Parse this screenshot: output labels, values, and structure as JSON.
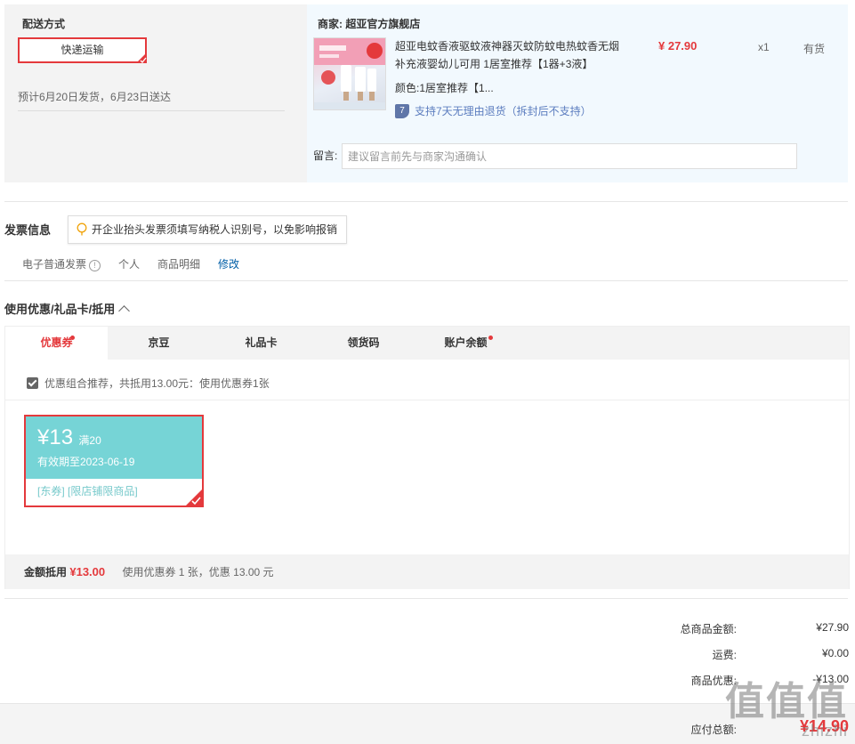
{
  "shipping": {
    "title": "配送方式",
    "method": "快递运输",
    "eta": "预计6月20日发货，6月23日送达"
  },
  "shop": {
    "label": "商家:",
    "name": "超亚官方旗舰店"
  },
  "product": {
    "title": "超亚电蚊香液驱蚊液神器灭蚊防蚊电热蚊香无烟补充液婴幼儿可用 1居室推荐【1器+3液】",
    "price": "¥ 27.90",
    "qty": "x1",
    "stock": "有货",
    "color_label": "颜色:",
    "color_value": "1居室推荐【1...",
    "return_icon": "7",
    "return_policy": "支持7天无理由退货（拆封后不支持）"
  },
  "message": {
    "label": "留言:",
    "placeholder": "建议留言前先与商家沟通确认"
  },
  "invoice": {
    "title": "发票信息",
    "tip": "开企业抬头发票须填写纳税人识别号，以免影响报销",
    "type": "电子普通发票",
    "info_icon": "!",
    "title_type": "个人",
    "content": "商品明细",
    "edit": "修改"
  },
  "discount": {
    "title": "使用优惠/礼品卡/抵用",
    "tabs": [
      {
        "label": "优惠券",
        "dot": true
      },
      {
        "label": "京豆",
        "dot": false
      },
      {
        "label": "礼品卡",
        "dot": false
      },
      {
        "label": "领货码",
        "dot": false
      },
      {
        "label": "账户余额",
        "dot": true
      }
    ],
    "combo_text": "优惠组合推荐，共抵用13.00元：使用优惠券1张",
    "coupon": {
      "amount": "¥13",
      "condition": "满20",
      "expiry": "有效期至2023-06-19",
      "tags": "[东券]  [限店铺限商品]"
    },
    "summary_label": "金额抵用",
    "summary_amount": "¥13.00",
    "summary_text": "使用优惠券 1 张，优惠 13.00 元"
  },
  "totals": {
    "goods_label": "总商品金额:",
    "goods_value": "¥27.90",
    "freight_label": "运费:",
    "freight_value": "¥0.00",
    "discount_label": "商品优惠:",
    "discount_value": "-¥13.00",
    "pay_label": "应付总额:",
    "pay_value": "¥14.90"
  },
  "watermark": {
    "big": "值值值",
    "small": "zhizhi"
  },
  "colors": {
    "accent_red": "#e4393c",
    "coupon_teal": "#76d4d6",
    "link_blue": "#005ea7"
  }
}
